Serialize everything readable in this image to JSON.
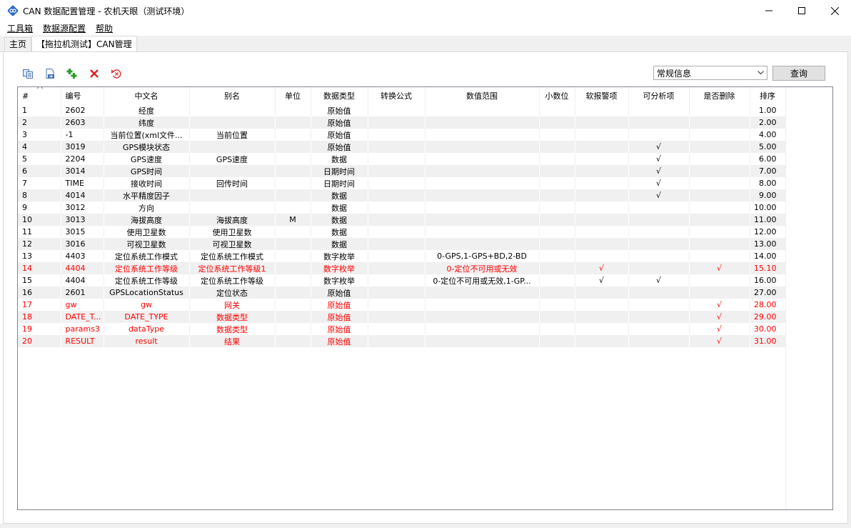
{
  "window": {
    "title": "CAN 数据配置管理 - 农机天眼（测试环境）",
    "minimize": "—",
    "maximize": "☐",
    "close": "✕"
  },
  "menu": {
    "items": [
      {
        "label": "工具箱"
      },
      {
        "label": "数据源配置"
      },
      {
        "label": "帮助"
      }
    ]
  },
  "tabs": [
    {
      "label": "主页",
      "active": false
    },
    {
      "label": "【拖拉机测试】CAN管理",
      "active": true
    }
  ],
  "toolbar": {
    "icons": [
      "copy-icon",
      "export-icon",
      "add-icon",
      "delete-icon",
      "undo-icon"
    ]
  },
  "filter": {
    "selected": "常规信息",
    "query_label": "查询"
  },
  "colors": {
    "red_text": "#ff0000",
    "alt_row": "#f0f0f0",
    "add_green": "#2a9d2a",
    "delete_red": "#e02020"
  },
  "grid": {
    "columns": [
      "#",
      "编号",
      "中文名",
      "别名",
      "单位",
      "数据类型",
      "转换公式",
      "数值范围",
      "小数位",
      "软报警项",
      "可分析项",
      "是否删除",
      "排序"
    ],
    "rows": [
      {
        "idx": "1",
        "code": "2602",
        "cn": "经度",
        "alias": "",
        "unit": "",
        "type": "原始值",
        "formula": "",
        "range": "",
        "dec": "",
        "alarm": "",
        "analyze": "",
        "deleted": "",
        "sort": "1.00",
        "red": false
      },
      {
        "idx": "2",
        "code": "2603",
        "cn": "纬度",
        "alias": "",
        "unit": "",
        "type": "原始值",
        "formula": "",
        "range": "",
        "dec": "",
        "alarm": "",
        "analyze": "",
        "deleted": "",
        "sort": "2.00",
        "red": false
      },
      {
        "idx": "3",
        "code": "-1",
        "cn": "当前位置(xml文件...",
        "alias": "当前位置",
        "unit": "",
        "type": "原始值",
        "formula": "",
        "range": "",
        "dec": "",
        "alarm": "",
        "analyze": "",
        "deleted": "",
        "sort": "4.00",
        "red": false
      },
      {
        "idx": "4",
        "code": "3019",
        "cn": "GPS模块状态",
        "alias": "",
        "unit": "",
        "type": "原始值",
        "formula": "",
        "range": "",
        "dec": "",
        "alarm": "",
        "analyze": "√",
        "deleted": "",
        "sort": "5.00",
        "red": false
      },
      {
        "idx": "5",
        "code": "2204",
        "cn": "GPS速度",
        "alias": "GPS速度",
        "unit": "",
        "type": "数据",
        "formula": "",
        "range": "",
        "dec": "",
        "alarm": "",
        "analyze": "√",
        "deleted": "",
        "sort": "6.00",
        "red": false
      },
      {
        "idx": "6",
        "code": "3014",
        "cn": "GPS时间",
        "alias": "",
        "unit": "",
        "type": "日期时间",
        "formula": "",
        "range": "",
        "dec": "",
        "alarm": "",
        "analyze": "√",
        "deleted": "",
        "sort": "7.00",
        "red": false
      },
      {
        "idx": "7",
        "code": "TIME",
        "cn": "接收时间",
        "alias": "回传时间",
        "unit": "",
        "type": "日期时间",
        "formula": "",
        "range": "",
        "dec": "",
        "alarm": "",
        "analyze": "√",
        "deleted": "",
        "sort": "8.00",
        "red": false
      },
      {
        "idx": "8",
        "code": "4014",
        "cn": "水平精度因子",
        "alias": "",
        "unit": "",
        "type": "数据",
        "formula": "",
        "range": "",
        "dec": "",
        "alarm": "",
        "analyze": "√",
        "deleted": "",
        "sort": "9.00",
        "red": false
      },
      {
        "idx": "9",
        "code": "3012",
        "cn": "方向",
        "alias": "",
        "unit": "",
        "type": "数据",
        "formula": "",
        "range": "",
        "dec": "",
        "alarm": "",
        "analyze": "",
        "deleted": "",
        "sort": "10.00",
        "red": false
      },
      {
        "idx": "10",
        "code": "3013",
        "cn": "海拔高度",
        "alias": "海拔高度",
        "unit": "M",
        "type": "数据",
        "formula": "",
        "range": "",
        "dec": "",
        "alarm": "",
        "analyze": "",
        "deleted": "",
        "sort": "11.00",
        "red": false
      },
      {
        "idx": "11",
        "code": "3015",
        "cn": "使用卫星数",
        "alias": "使用卫星数",
        "unit": "",
        "type": "数据",
        "formula": "",
        "range": "",
        "dec": "",
        "alarm": "",
        "analyze": "",
        "deleted": "",
        "sort": "12.00",
        "red": false
      },
      {
        "idx": "12",
        "code": "3016",
        "cn": "可视卫星数",
        "alias": "可视卫星数",
        "unit": "",
        "type": "数据",
        "formula": "",
        "range": "",
        "dec": "",
        "alarm": "",
        "analyze": "",
        "deleted": "",
        "sort": "13.00",
        "red": false
      },
      {
        "idx": "13",
        "code": "4403",
        "cn": "定位系统工作模式",
        "alias": "定位系统工作模式",
        "unit": "",
        "type": "数字枚举",
        "formula": "",
        "range": "0-GPS,1-GPS+BD,2-BD",
        "dec": "",
        "alarm": "",
        "analyze": "",
        "deleted": "",
        "sort": "14.00",
        "red": false
      },
      {
        "idx": "14",
        "code": "4404",
        "cn": "定位系统工作等级",
        "alias": "定位系统工作等级1",
        "unit": "",
        "type": "数字枚举",
        "formula": "",
        "range": "0-定位不可用或无效",
        "dec": "",
        "alarm": "√",
        "analyze": "",
        "deleted": "√",
        "sort": "15.10",
        "red": true
      },
      {
        "idx": "15",
        "code": "4404",
        "cn": "定位系统工作等级",
        "alias": "定位系统工作等级",
        "unit": "",
        "type": "数字枚举",
        "formula": "",
        "range": "0-定位不可用或无效,1-GP...",
        "dec": "",
        "alarm": "√",
        "analyze": "√",
        "deleted": "",
        "sort": "16.00",
        "red": false
      },
      {
        "idx": "16",
        "code": "2601",
        "cn": "GPSLocationStatus",
        "alias": "定位状态",
        "unit": "",
        "type": "原始值",
        "formula": "",
        "range": "",
        "dec": "",
        "alarm": "",
        "analyze": "",
        "deleted": "",
        "sort": "27.00",
        "red": false
      },
      {
        "idx": "17",
        "code": "gw",
        "cn": "gw",
        "alias": "网关",
        "unit": "",
        "type": "原始值",
        "formula": "",
        "range": "",
        "dec": "",
        "alarm": "",
        "analyze": "",
        "deleted": "√",
        "sort": "28.00",
        "red": true
      },
      {
        "idx": "18",
        "code": "DATE_T...",
        "cn": "DATE_TYPE",
        "alias": "数据类型",
        "unit": "",
        "type": "原始值",
        "formula": "",
        "range": "",
        "dec": "",
        "alarm": "",
        "analyze": "",
        "deleted": "√",
        "sort": "29.00",
        "red": true
      },
      {
        "idx": "19",
        "code": "params3",
        "cn": "dataType",
        "alias": "数据类型",
        "unit": "",
        "type": "原始值",
        "formula": "",
        "range": "",
        "dec": "",
        "alarm": "",
        "analyze": "",
        "deleted": "√",
        "sort": "30.00",
        "red": true
      },
      {
        "idx": "20",
        "code": "RESULT",
        "cn": "result",
        "alias": "结果",
        "unit": "",
        "type": "原始值",
        "formula": "",
        "range": "",
        "dec": "",
        "alarm": "",
        "analyze": "",
        "deleted": "√",
        "sort": "31.00",
        "red": true
      }
    ]
  }
}
